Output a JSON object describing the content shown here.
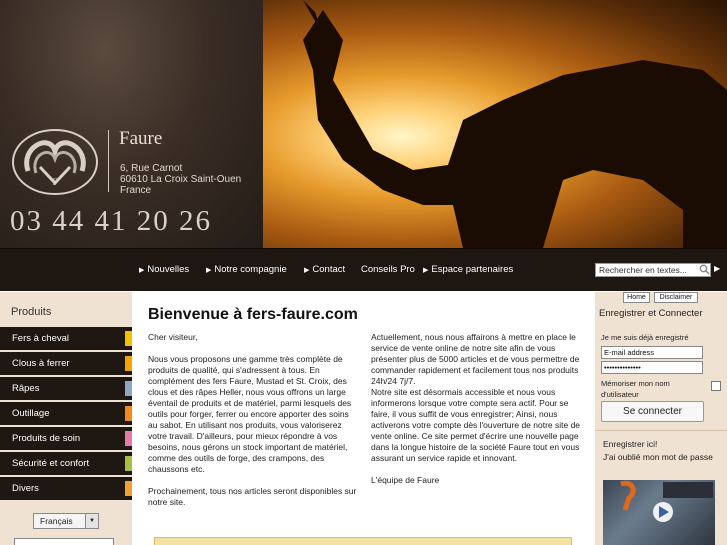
{
  "brand": {
    "name": "Faure",
    "address": [
      "6, Rue Carnot",
      "60610 La Croix Saint-Ouen",
      "France"
    ],
    "phone": "03 44 41 20 26"
  },
  "nav": {
    "items": [
      "Nouvelles",
      "Notre compagnie",
      "Contact",
      "Conseils Pro",
      "Espace partenaires"
    ],
    "search_placeholder": "Rechercher en textes..."
  },
  "products": {
    "title": "Produits",
    "items": [
      {
        "label": "Fers à cheval",
        "color": "#f2c200"
      },
      {
        "label": "Clous à ferrer",
        "color": "#f2a600"
      },
      {
        "label": "Râpes",
        "color": "#8da6c4"
      },
      {
        "label": "Outillage",
        "color": "#f08a1c"
      },
      {
        "label": "Produits de soin",
        "color": "#e87aa8"
      },
      {
        "label": "Sécurité et confort",
        "color": "#a8c040"
      },
      {
        "label": "Divers",
        "color": "#f0a030"
      }
    ],
    "language": "Français"
  },
  "main": {
    "title": "Bienvenue à fers-faure.com",
    "col1": [
      "Cher visiteur,",
      "Nous vous proposons une gamme très complète de produits de qualité, qui s'adressent à tous. En complément des fers Faure, Mustad et St. Croix, des clous et des râpes Heller, nous vous offrons un large éventail de produits et de matériel, parmi lesquels des outils pour forger, ferrer ou encore apporter des soins au sabot. En utilisant nos produits, vous valoriserez votre travail. D'ailleurs, pour mieux répondre à vos besoins, nous gérons un stock important de matériel, comme des outils de forge, des crampons, des chaussons etc.",
      "Prochainement, tous nos articles seront disponibles sur notre site."
    ],
    "col2": [
      "Actuellement, nous nous affairons à mettre en place le service de vente online de notre site afin de vous présenter plus de 5000 articles et de vous permettre de commander rapidement et facilement tous nos produits 24h/24 7j/7.\nNotre site est désormais accessible et nous vous informerons lorsque votre compte sera actif. Pour se faire, il vous suffit de vous enregistrer; Ainsi, nous activerons votre compte dès l'ouverture de notre site de vente online. Ce site permet d'écrire une nouvelle page dans la longue histoire de la société Faure tout en vous assurant un service rapide et innovant.",
      "L'équipe de Faure"
    ]
  },
  "account": {
    "home": "Home",
    "disclaimer": "Disclaimer",
    "title": "Enregistrer et Connecter",
    "already": "Je me suis déjà enregistré",
    "email_placeholder": "E-mail address",
    "password_value": "••••••••••••••",
    "remember": "Mémoriser mon nom d'utilisateur",
    "connect": "Se connecter",
    "register": "Enregistrer ici!",
    "forgot": "J'ai oublié mon mot de passe"
  },
  "icons": {
    "search": "search-icon",
    "play": "play-icon",
    "logo": "horseshoe-logo-icon"
  }
}
